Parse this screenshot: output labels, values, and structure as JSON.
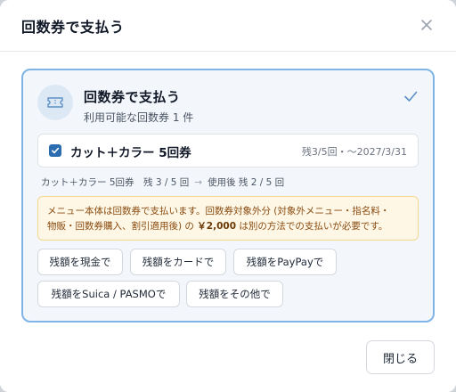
{
  "dialog": {
    "title": "回数券で支払う"
  },
  "option": {
    "title": "回数券で支払う",
    "subtitle": "利用可能な回数券 1 件",
    "icon": "ticket-icon",
    "selected": true
  },
  "ticket": {
    "name": "カット＋カラー 5回券",
    "meta": "残3/5回・〜2027/3/31",
    "checked": true
  },
  "usage": {
    "before": "カット＋カラー 5回券　残 3 / 5 回",
    "after": "使用後 残 2 / 5 回"
  },
  "notice": {
    "line1": "メニュー本体は回数券で支払います。回数券対象外分 (対象外メニュー・指名料・",
    "line2_prefix": "物販・回数券購入、割引適用後) の ",
    "amount": "￥2,000",
    "line2_suffix": " は別の方法での支払いが必要です。"
  },
  "pay_buttons": {
    "cash": "残額を現金で",
    "card": "残額をカードで",
    "paypay": "残額をPayPayで",
    "suica": "残額をSuica / PASMOで",
    "other": "残額をその他で"
  },
  "footer": {
    "close_label": "閉じる"
  },
  "colors": {
    "accent": "#2b6cb0",
    "card_border": "#7fb4e6",
    "card_bg": "#f3f7fc",
    "notice_bg": "#fef7e6",
    "notice_text": "#8a4b0f"
  }
}
